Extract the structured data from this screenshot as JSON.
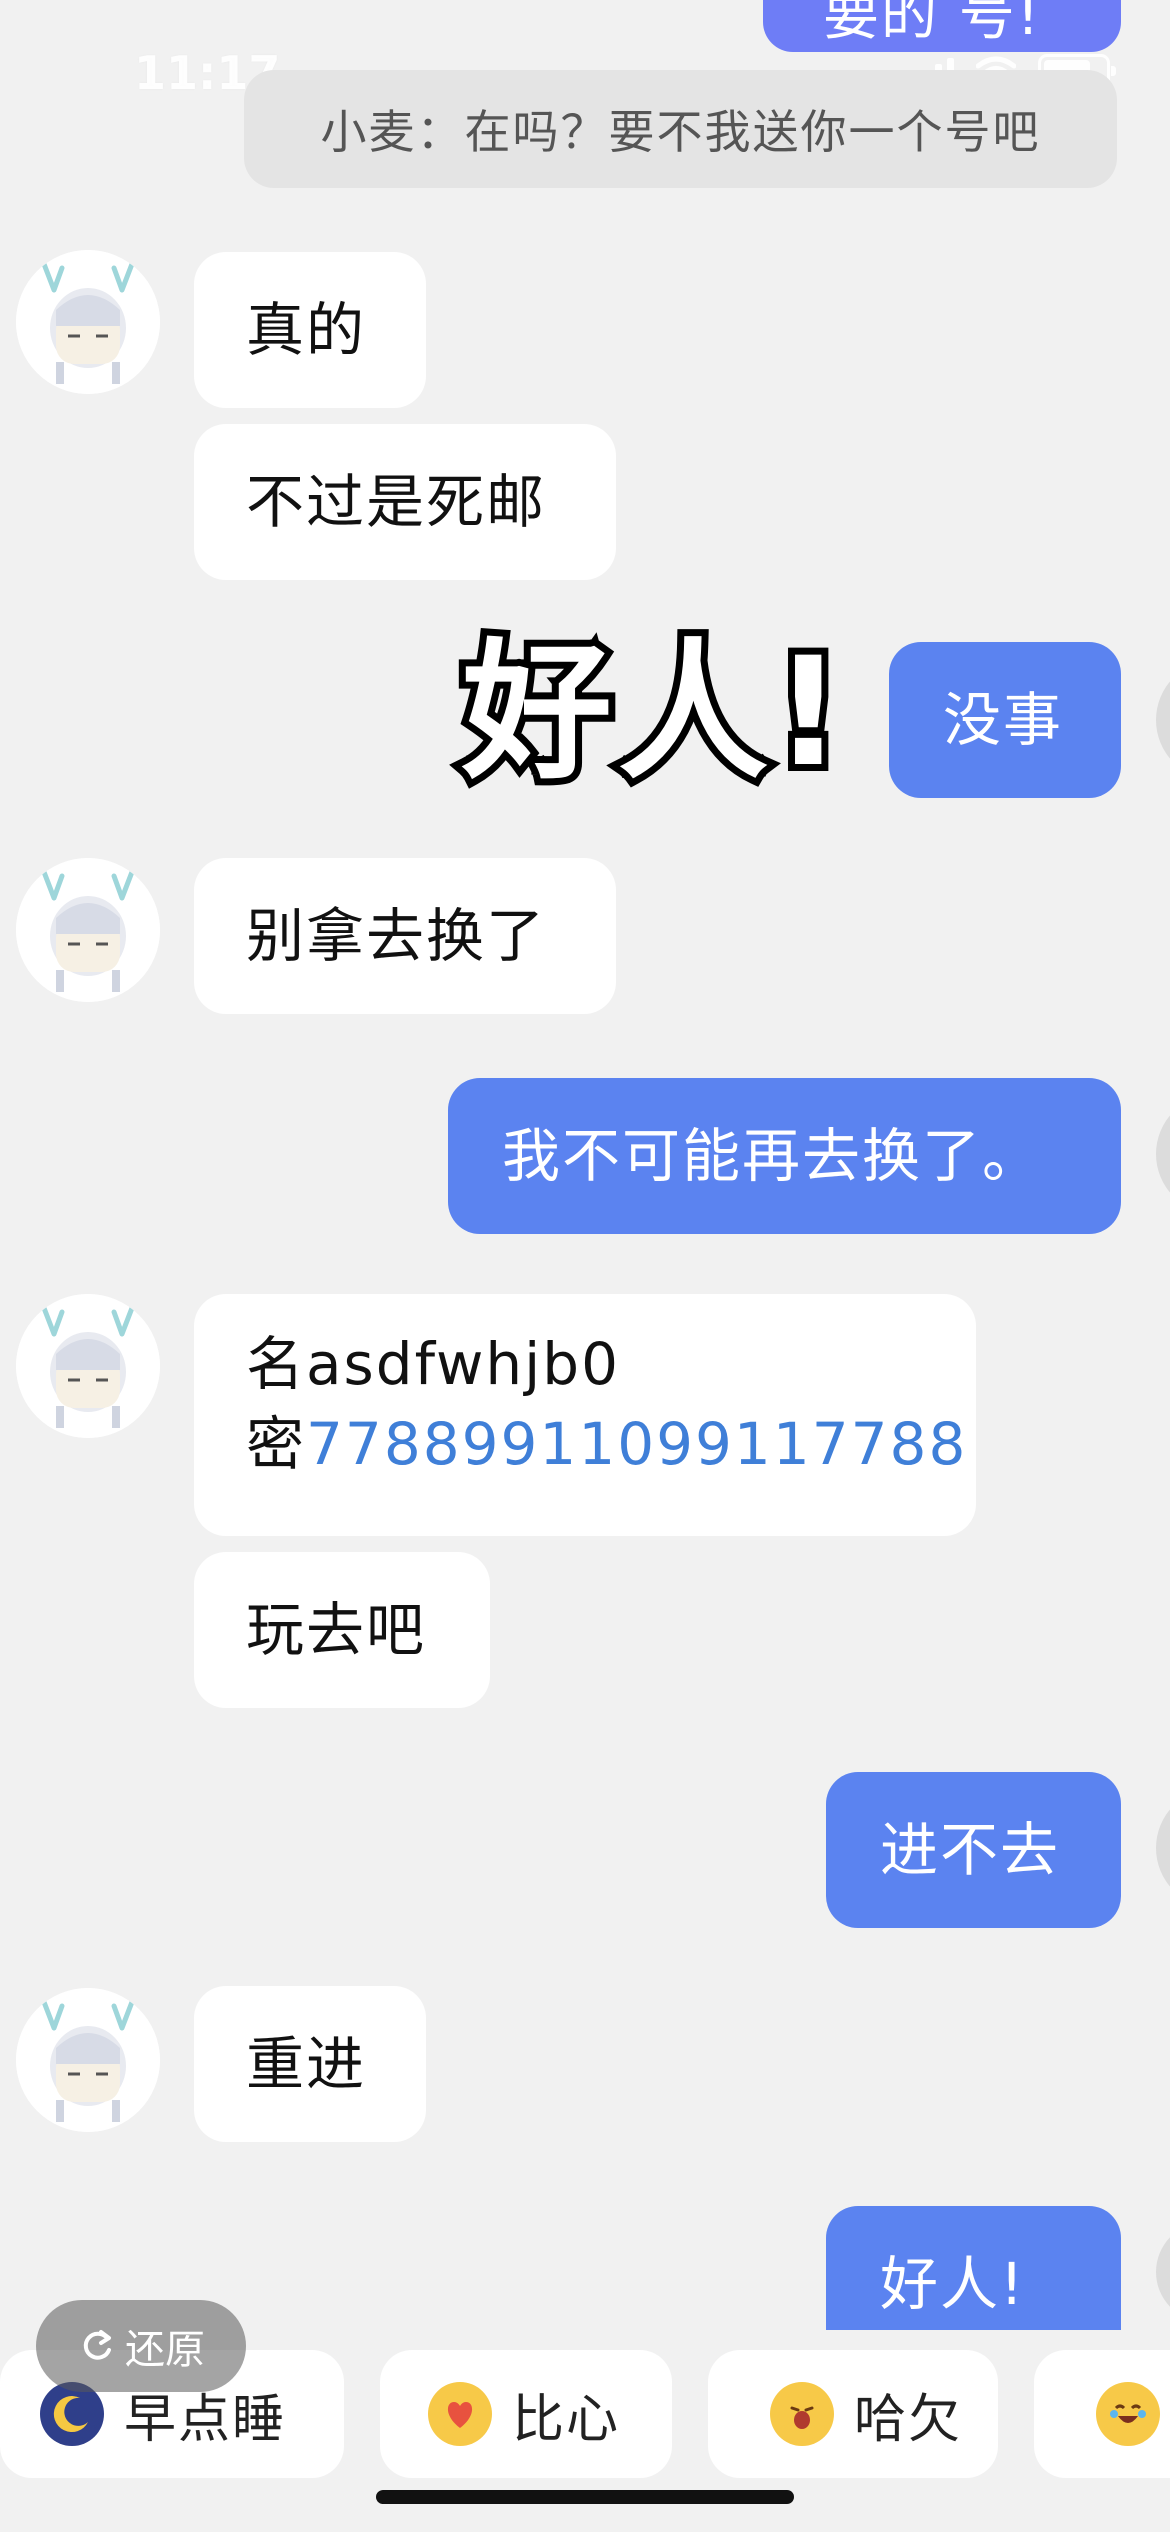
{
  "status_bar": {
    "time": "11:17"
  },
  "top_cut_message": {
    "text": "要的 号!"
  },
  "notification_banner": {
    "text": "小麦：在吗？要不我送你一个号吧"
  },
  "messages": [
    {
      "side": "received",
      "text": "真的"
    },
    {
      "side": "received",
      "text": "不过是死邮"
    },
    {
      "side": "sent",
      "text": "没事"
    },
    {
      "side": "received",
      "text": "别拿去换了"
    },
    {
      "side": "sent",
      "text": "我不可能再去换了。"
    },
    {
      "side": "received",
      "line1": "名asdfwhjb0",
      "line2_prefix": "密",
      "line2_link": "77889911099117788"
    },
    {
      "side": "received",
      "text": "玩去吧"
    },
    {
      "side": "sent",
      "text": "进不去"
    },
    {
      "side": "received",
      "text": "重进"
    },
    {
      "side": "sent",
      "text": "好人!"
    }
  ],
  "sticker": {
    "text": "好人!"
  },
  "restore_button": {
    "label": "还原"
  },
  "quick_replies": [
    {
      "label": "早点睡",
      "icon": "moon-emoji-icon"
    },
    {
      "label": "比心",
      "icon": "heart-hands-emoji-icon"
    },
    {
      "label": "哈欠",
      "icon": "yawn-emoji-icon"
    },
    {
      "label": "",
      "icon": "laugh-cry-emoji-icon"
    }
  ],
  "colors": {
    "sent_bubble": "#5b83f0",
    "received_bubble": "#ffffff",
    "background": "#f1f1f1",
    "link": "#3f7fd8"
  }
}
